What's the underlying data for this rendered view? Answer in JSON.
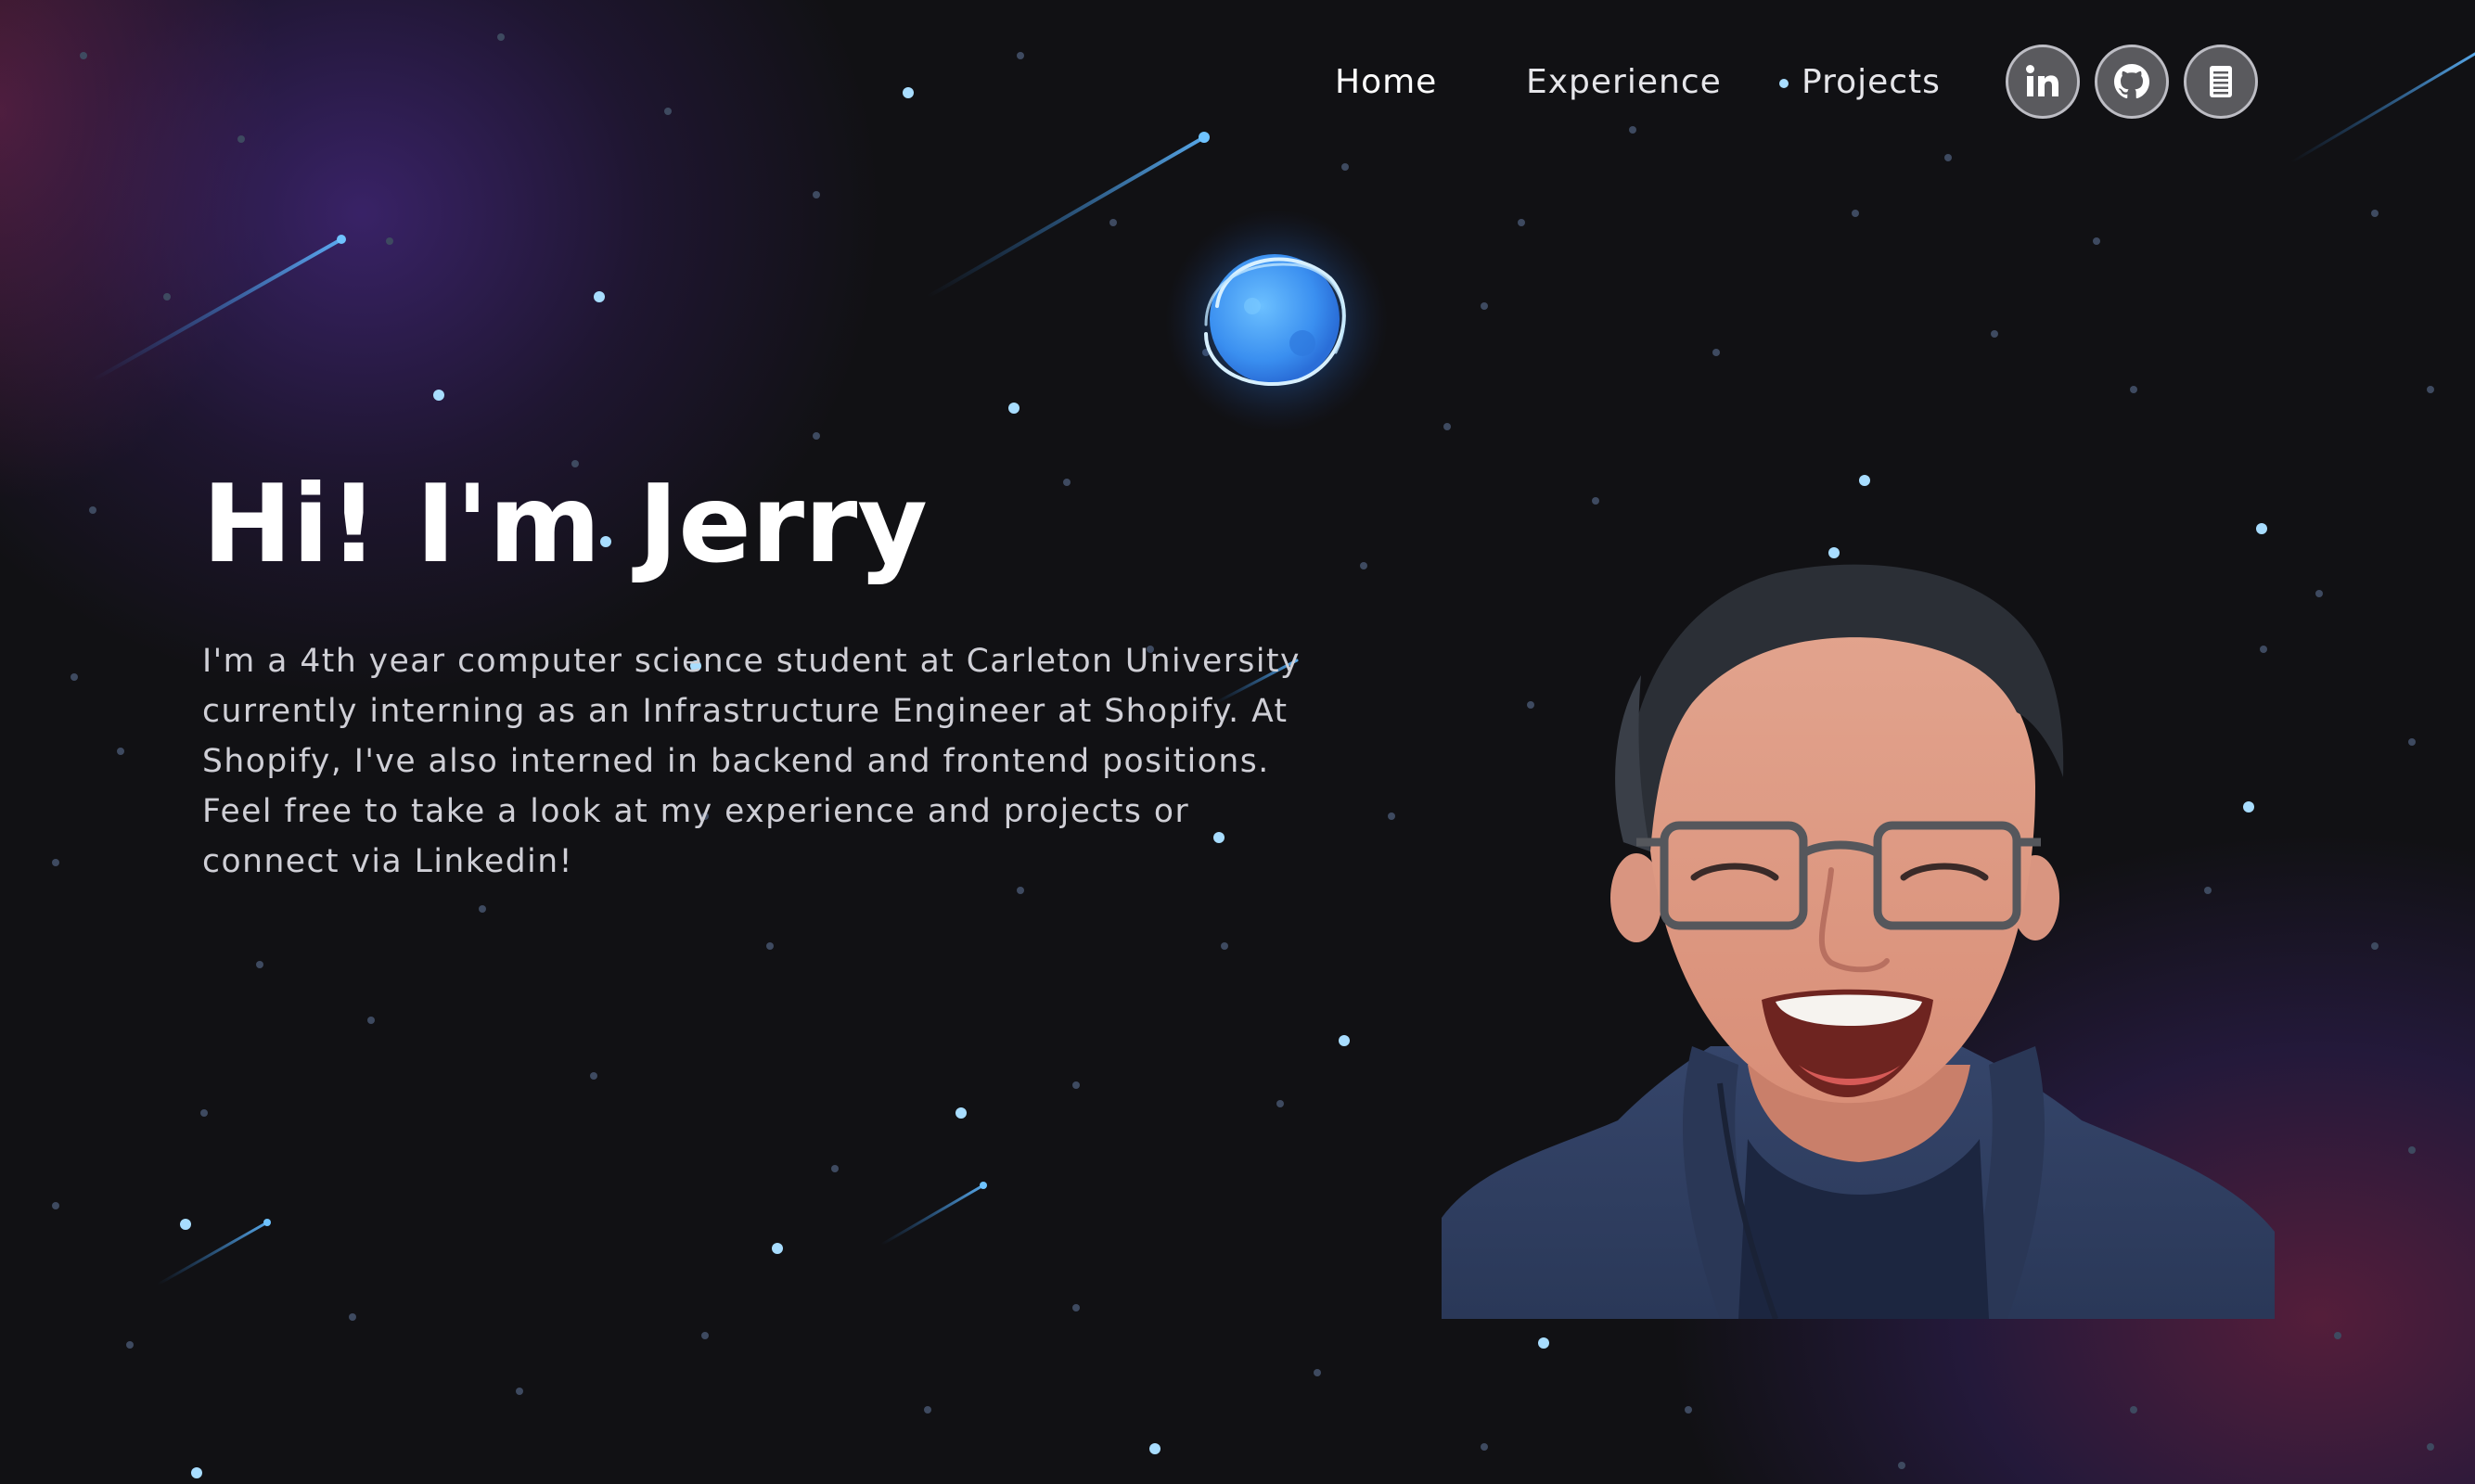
{
  "nav": {
    "links": [
      {
        "label": "Home",
        "active": true
      },
      {
        "label": "Experience",
        "active": false
      },
      {
        "label": "Projects",
        "active": false
      }
    ],
    "icons": [
      {
        "name": "linkedin-icon",
        "glyph": "in"
      },
      {
        "name": "github-icon",
        "glyph": "github"
      },
      {
        "name": "resume-icon",
        "glyph": "document"
      }
    ]
  },
  "hero": {
    "title": "Hi! I'm Jerry",
    "description": "I'm a 4th year computer science student at Carleton University currently interning as an Infrastructure Engineer at Shopify. At Shopify, I've also interned in backend and frontend positions. Feel free to take a look at my experience and projects or connect via Linkedin!"
  },
  "colors": {
    "background": "#111114",
    "accent": "#4aa6ff",
    "star": "#9ed8ff",
    "text": "#cfcfd6"
  }
}
